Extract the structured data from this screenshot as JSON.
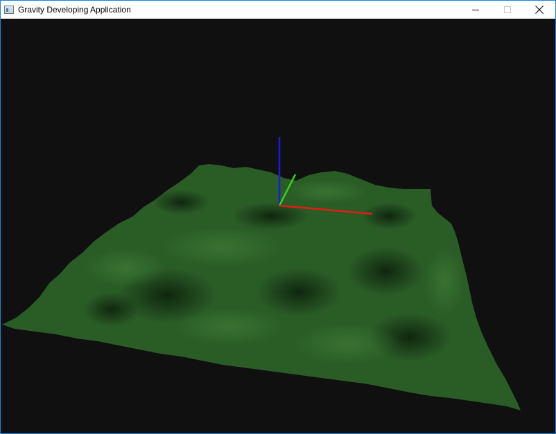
{
  "window": {
    "title": "Gravity Developing Application",
    "app_icon": "application-icon",
    "controls": {
      "minimize_icon": "minimize-icon",
      "maximize_icon": "maximize-icon",
      "close_icon": "close-icon"
    }
  },
  "scene": {
    "background_color": "#101010",
    "terrain_color": "#2a5c26",
    "axes": [
      {
        "name": "x-axis",
        "color": "#e11e14"
      },
      {
        "name": "y-axis",
        "color": "#3ad11a"
      },
      {
        "name": "z-axis",
        "color": "#1c1ae0"
      }
    ]
  }
}
